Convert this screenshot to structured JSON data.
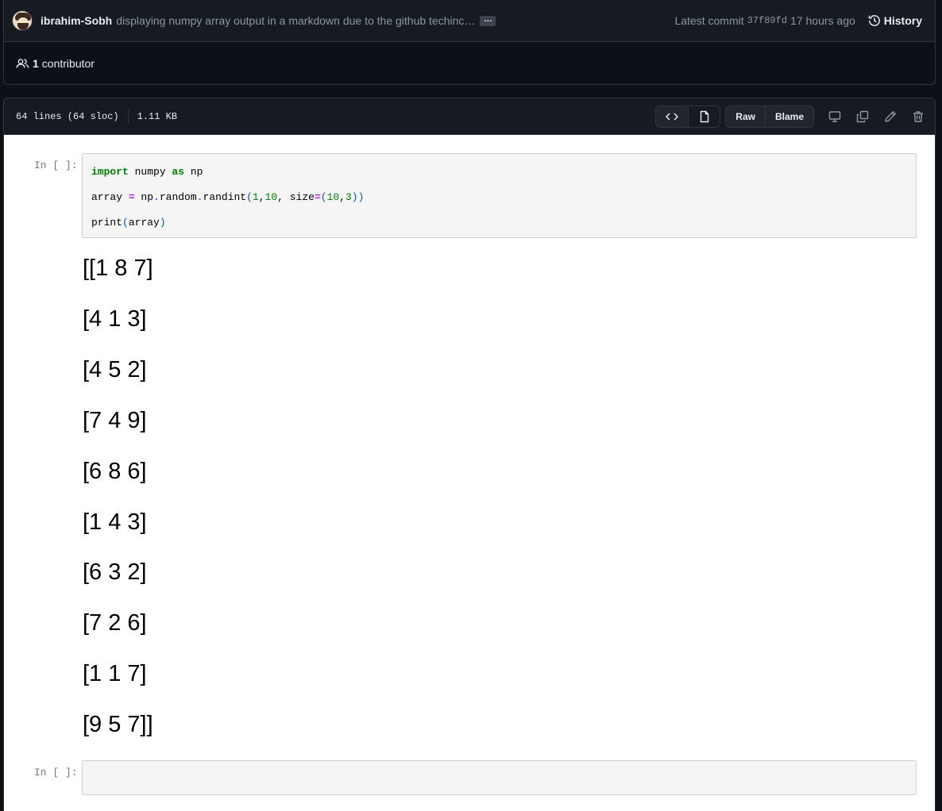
{
  "commit": {
    "author": "ibrahim-Sobh",
    "message": "displaying numpy array output in a markdown due to the github techinc…",
    "ellipsis": "…",
    "latest_label": "Latest commit",
    "sha": "37f89fd",
    "time_ago": "17 hours ago",
    "history_label": "History",
    "contributors_count": "1",
    "contributors_label": "contributor"
  },
  "file": {
    "lines_info": "64 lines (64 sloc)",
    "size": "1.11 KB",
    "raw_label": "Raw",
    "blame_label": "Blame"
  },
  "notebook": {
    "prompt1": "In [ ]:",
    "code": {
      "line1_kw1": "import",
      "line1_mid": " numpy ",
      "line1_kw2": "as",
      "line1_end": " np",
      "line2_a": "array ",
      "line2_eq": "=",
      "line2_b": " np",
      "line2_dot1": ".",
      "line2_c": "random",
      "line2_dot2": ".",
      "line2_d": "randint",
      "line2_p1": "(",
      "line2_n1": "1",
      "line2_comma1": ",",
      "line2_n2": "10",
      "line2_comma2": ", size",
      "line2_eq2": "=",
      "line2_p2": "(",
      "line2_n3": "10",
      "line2_comma3": ",",
      "line2_n4": "3",
      "line2_p3": "))",
      "line3_a": "print",
      "line3_p1": "(",
      "line3_b": "array",
      "line3_p2": ")"
    },
    "output": [
      "[[1 8 7]",
      "[4 1 3]",
      "[4 5 2]",
      "[7 4 9]",
      "[6 8 6]",
      "[1 4 3]",
      "[6 3 2]",
      "[7 2 6]",
      "[1 1 7]",
      "[9 5 7]]"
    ],
    "prompt2": "In [ ]:"
  }
}
